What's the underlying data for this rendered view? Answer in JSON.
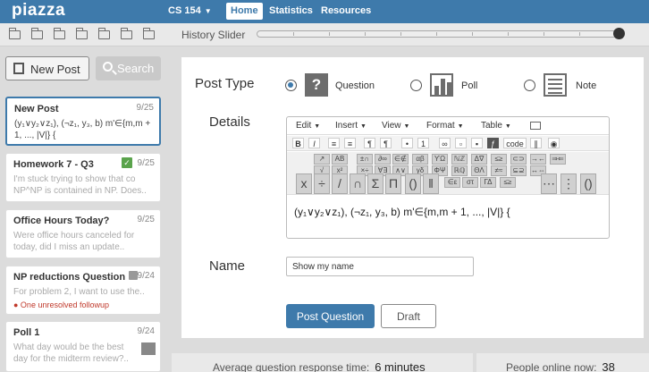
{
  "topbar": {
    "logo": "piazza",
    "course": "CS 154",
    "tabs": [
      {
        "label": "Home",
        "active": true
      },
      {
        "label": "Statistics",
        "active": false
      },
      {
        "label": "Resources",
        "active": false
      }
    ]
  },
  "history": {
    "label": "History Slider"
  },
  "sidebar": {
    "new_post_label": "New Post",
    "search_label": "Search",
    "posts": [
      {
        "title": "New Post",
        "date": "9/25",
        "snippet": "(y₁∨y₂∨z₁), (¬z₁, y₃, b)    m'∈{m,m + 1, ..., |V|} {",
        "selected": true
      },
      {
        "title": "Homework 7 - Q3",
        "date": "9/25",
        "snippet": "I'm stuck trying to show that co NP^NP is contained in NP. Does..",
        "selected": false
      },
      {
        "title": "Office Hours Today?",
        "date": "9/25",
        "snippet": "Were office hours canceled for today, did I miss an update..",
        "selected": false
      },
      {
        "title": "NP reductions Question",
        "date": "9/24",
        "snippet": "For problem 2, I want to use the..",
        "alert": "● One unresolved followup",
        "selected": false
      },
      {
        "title": "Poll 1",
        "date": "9/24",
        "snippet": "What day would be the best day for the midterm review?..",
        "selected": false
      }
    ]
  },
  "compose": {
    "post_type_label": "Post Type",
    "types": [
      {
        "label": "Question",
        "icon": "question-icon",
        "selected": true
      },
      {
        "label": "Poll",
        "icon": "poll-icon",
        "selected": false
      },
      {
        "label": "Note",
        "icon": "note-icon",
        "selected": false
      }
    ],
    "details_label": "Details",
    "editor": {
      "menus": [
        "Edit",
        "Insert",
        "View",
        "Format",
        "Table"
      ],
      "content": "(y₁∨y₂∨z₁), (¬z₁, y₃, b)    m'∈{m,m + 1, ..., |V|} {",
      "code_label": "code"
    },
    "name_label": "Name",
    "name_value": "Show my name",
    "post_button": "Post Question",
    "draft_button": "Draft"
  },
  "footer": {
    "response_label": "Average question response time:",
    "response_value": "6 minutes",
    "online_label": "People online now:",
    "online_value": "38"
  },
  "colors": {
    "accent": "#3e7aab",
    "panel": "#ffffff",
    "background": "#dcdcdc",
    "alert": "#c0392b",
    "resolved": "#5aa34c"
  }
}
